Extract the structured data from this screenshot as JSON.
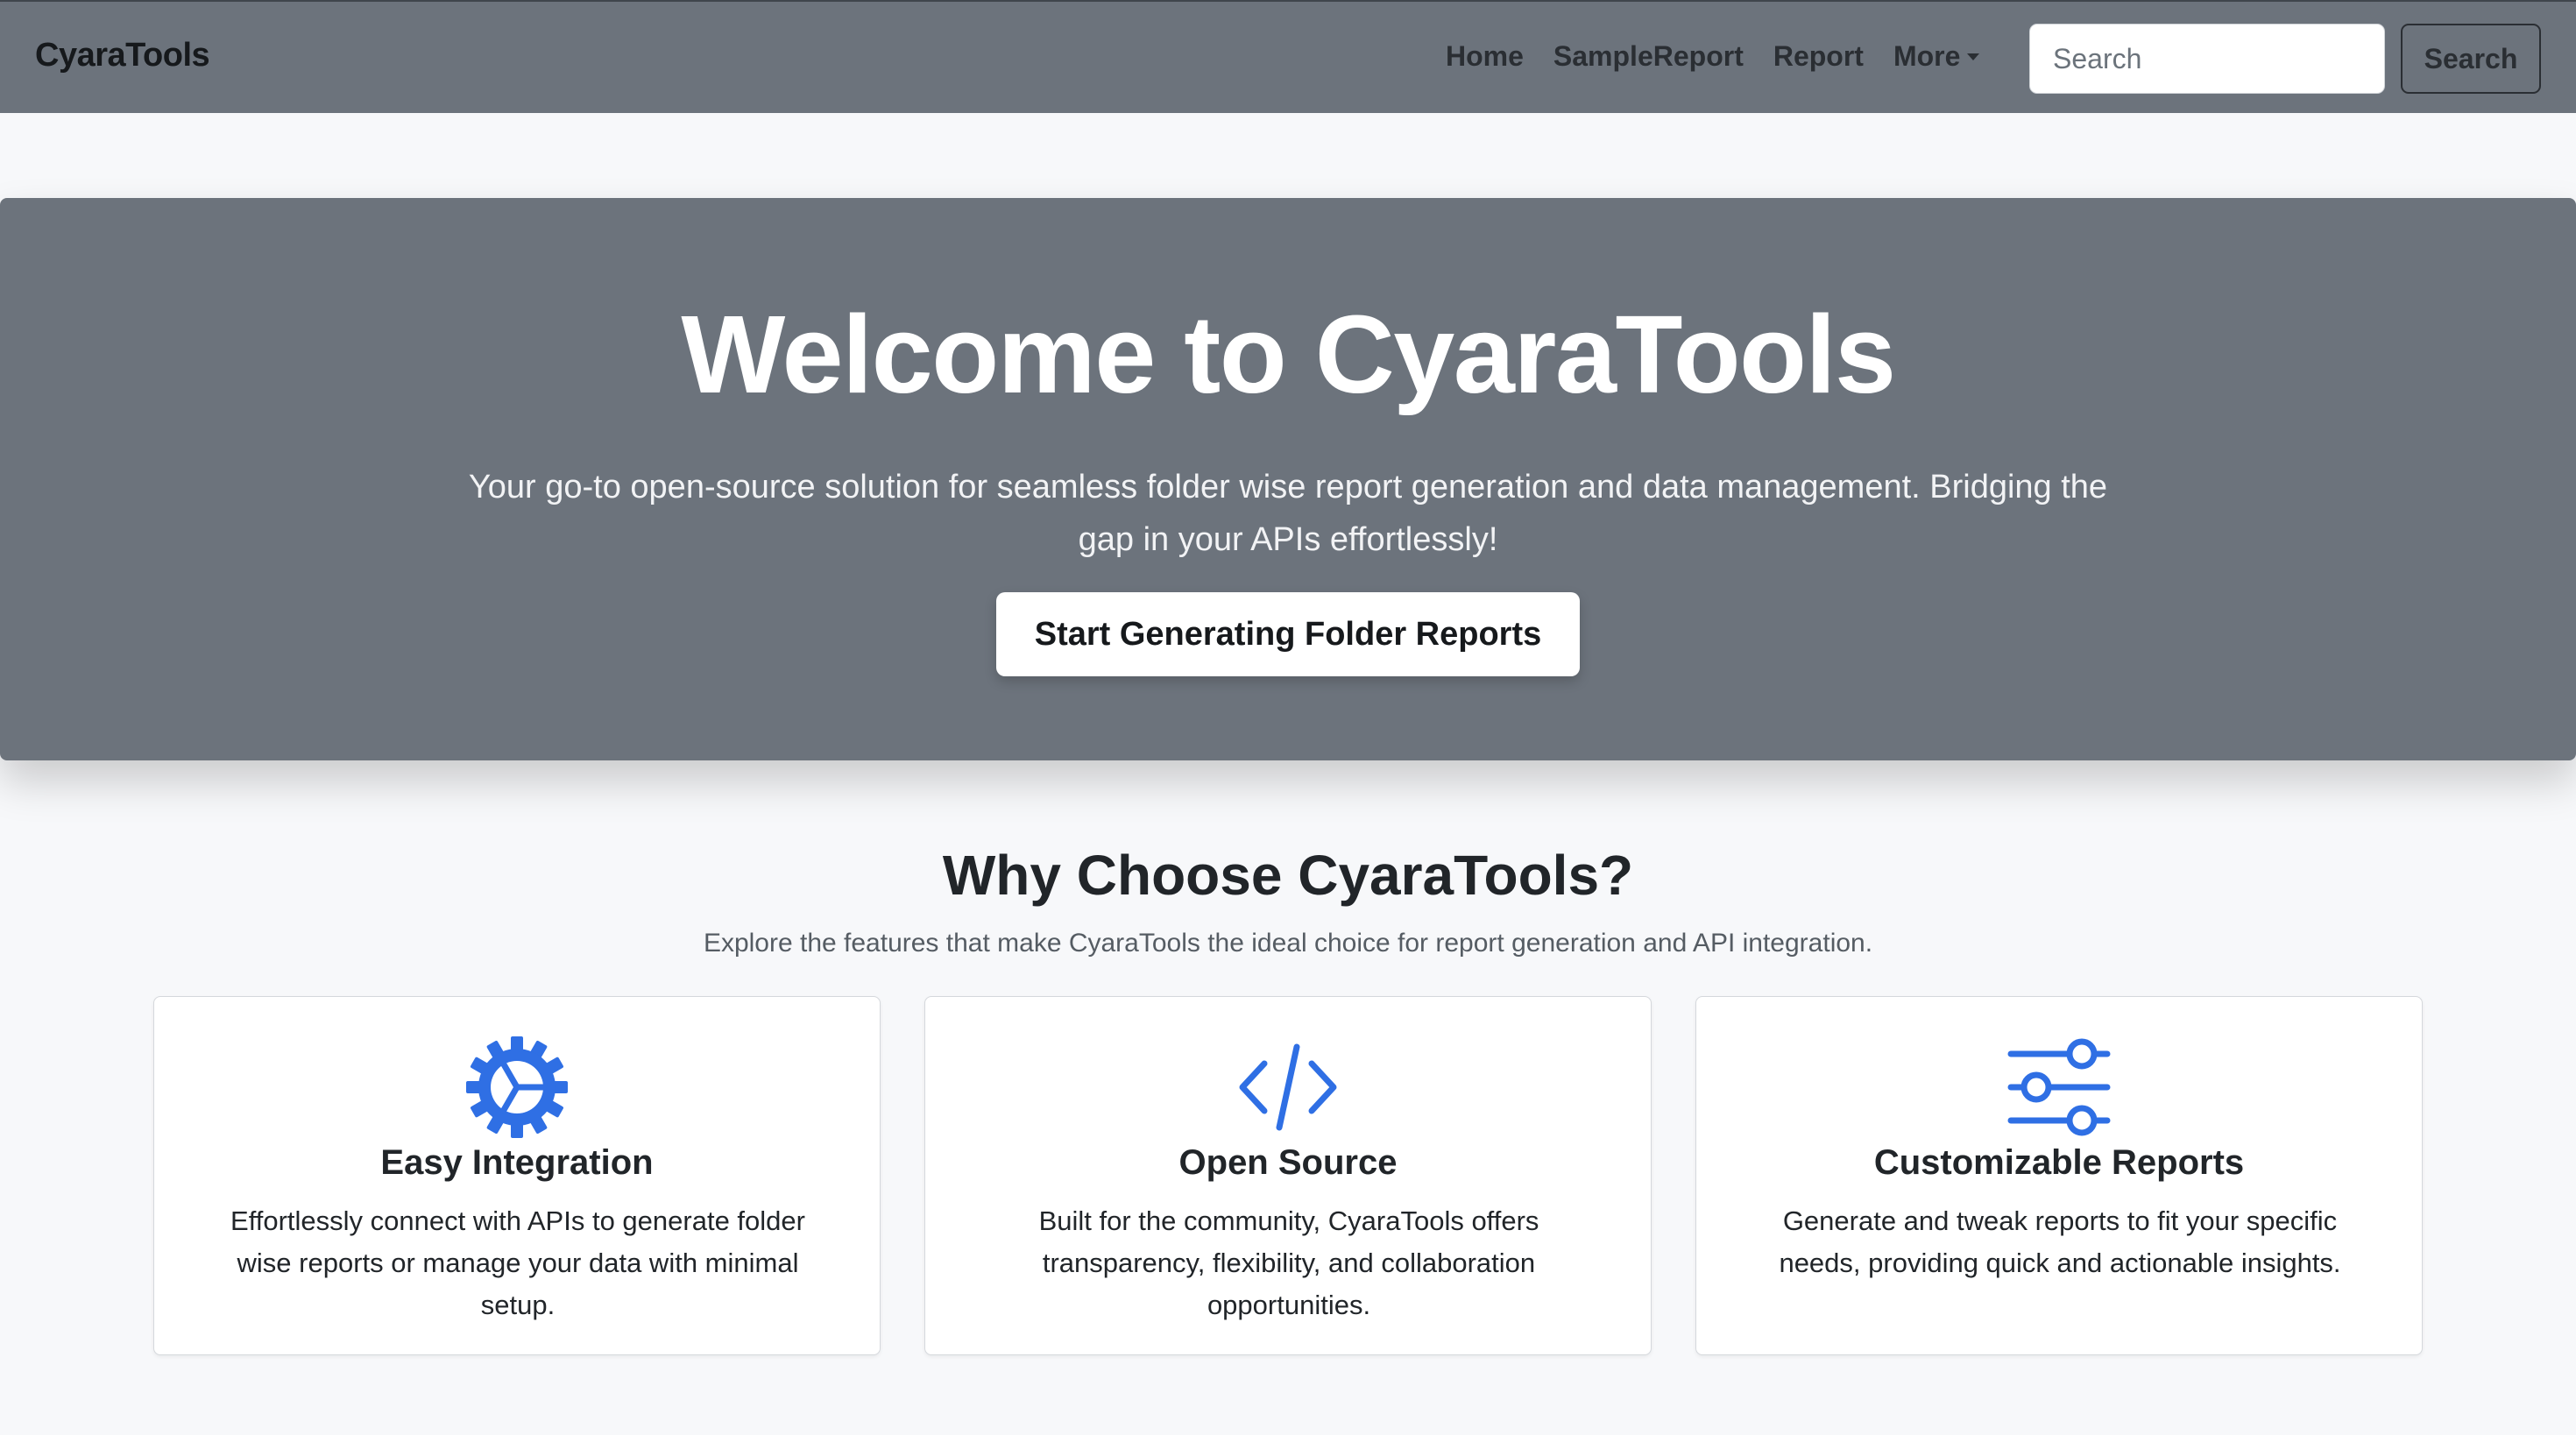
{
  "colors": {
    "accent": "#2f6fe4",
    "navbar": "#6c737c",
    "hero": "#6c737c",
    "background": "#f7f8fa"
  },
  "navbar": {
    "brand": "CyaraTools",
    "links": [
      {
        "label": "Home"
      },
      {
        "label": "SampleReport"
      },
      {
        "label": "Report"
      },
      {
        "label": "More",
        "dropdown": true
      }
    ],
    "search": {
      "placeholder": "Search",
      "value": "",
      "button_label": "Search"
    }
  },
  "hero": {
    "title": "Welcome to CyaraTools",
    "subtitle": "Your go-to open-source solution for seamless folder wise report generation and data management. Bridging the gap in your APIs effortlessly!",
    "cta_label": "Start Generating Folder Reports"
  },
  "features": {
    "title": "Why Choose CyaraTools?",
    "subtitle": "Explore the features that make CyaraTools the ideal choice for report generation and API integration.",
    "cards": [
      {
        "icon": "gear-icon",
        "title": "Easy Integration",
        "text": "Effortlessly connect with APIs to generate folder wise reports or manage your data with minimal setup."
      },
      {
        "icon": "code-icon",
        "title": "Open Source",
        "text": "Built for the community, CyaraTools offers transparency, flexibility, and collaboration opportunities."
      },
      {
        "icon": "sliders-icon",
        "title": "Customizable Reports",
        "text": "Generate and tweak reports to fit your specific needs, providing quick and actionable insights."
      }
    ]
  }
}
